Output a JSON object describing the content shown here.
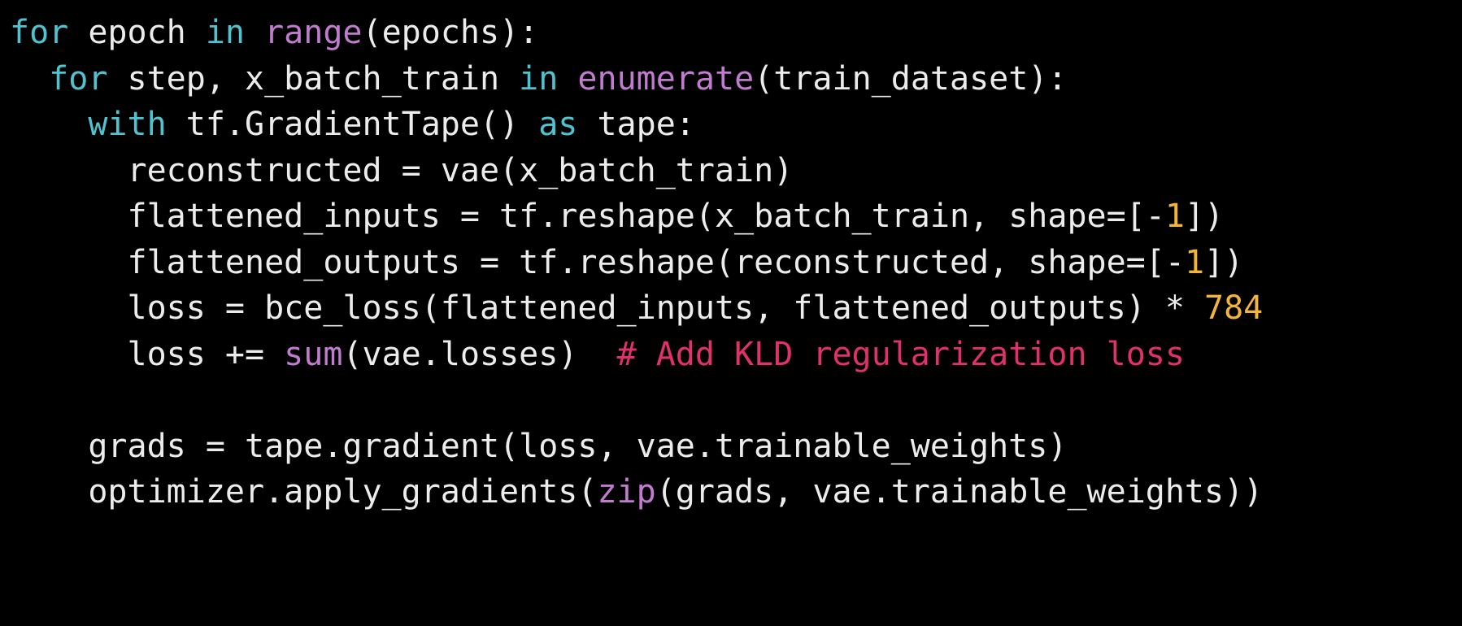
{
  "colors": {
    "background": "#000000",
    "text": "#ececec",
    "keyword": "#4fc3cf",
    "builtin": "#c17ccf",
    "number": "#f2b43a",
    "comment": "#e0316a"
  },
  "code": {
    "language": "python",
    "lines": [
      {
        "indent": 0,
        "tokens": [
          {
            "type": "kw",
            "text": "for"
          },
          {
            "type": "tx",
            "text": " epoch "
          },
          {
            "type": "kw",
            "text": "in"
          },
          {
            "type": "tx",
            "text": " "
          },
          {
            "type": "fn",
            "text": "range"
          },
          {
            "type": "tx",
            "text": "(epochs):"
          }
        ]
      },
      {
        "indent": 1,
        "tokens": [
          {
            "type": "kw",
            "text": "for"
          },
          {
            "type": "tx",
            "text": " step, x_batch_train "
          },
          {
            "type": "kw",
            "text": "in"
          },
          {
            "type": "tx",
            "text": " "
          },
          {
            "type": "fn",
            "text": "enumerate"
          },
          {
            "type": "tx",
            "text": "(train_dataset):"
          }
        ]
      },
      {
        "indent": 2,
        "tokens": [
          {
            "type": "kw",
            "text": "with"
          },
          {
            "type": "tx",
            "text": " tf.GradientTape() "
          },
          {
            "type": "kw",
            "text": "as"
          },
          {
            "type": "tx",
            "text": " tape:"
          }
        ]
      },
      {
        "indent": 3,
        "tokens": [
          {
            "type": "tx",
            "text": "reconstructed = vae(x_batch_train)"
          }
        ]
      },
      {
        "indent": 3,
        "tokens": [
          {
            "type": "tx",
            "text": "flattened_inputs = tf.reshape(x_batch_train, shape=[-"
          },
          {
            "type": "num",
            "text": "1"
          },
          {
            "type": "tx",
            "text": "])"
          }
        ]
      },
      {
        "indent": 3,
        "tokens": [
          {
            "type": "tx",
            "text": "flattened_outputs = tf.reshape(reconstructed, shape=[-"
          },
          {
            "type": "num",
            "text": "1"
          },
          {
            "type": "tx",
            "text": "])"
          }
        ]
      },
      {
        "indent": 3,
        "tokens": [
          {
            "type": "tx",
            "text": "loss = bce_loss(flattened_inputs, flattened_outputs) * "
          },
          {
            "type": "num",
            "text": "784"
          }
        ]
      },
      {
        "indent": 3,
        "tokens": [
          {
            "type": "tx",
            "text": "loss += "
          },
          {
            "type": "fn",
            "text": "sum"
          },
          {
            "type": "tx",
            "text": "(vae.losses)  "
          },
          {
            "type": "cm",
            "text": "# Add KLD regularization loss"
          }
        ]
      },
      {
        "indent": 0,
        "tokens": []
      },
      {
        "indent": 2,
        "tokens": [
          {
            "type": "tx",
            "text": "grads = tape.gradient(loss, vae.trainable_weights)"
          }
        ]
      },
      {
        "indent": 2,
        "tokens": [
          {
            "type": "tx",
            "text": "optimizer.apply_gradients("
          },
          {
            "type": "fn",
            "text": "zip"
          },
          {
            "type": "tx",
            "text": "(grads, vae.trainable_weights))"
          }
        ]
      }
    ]
  }
}
